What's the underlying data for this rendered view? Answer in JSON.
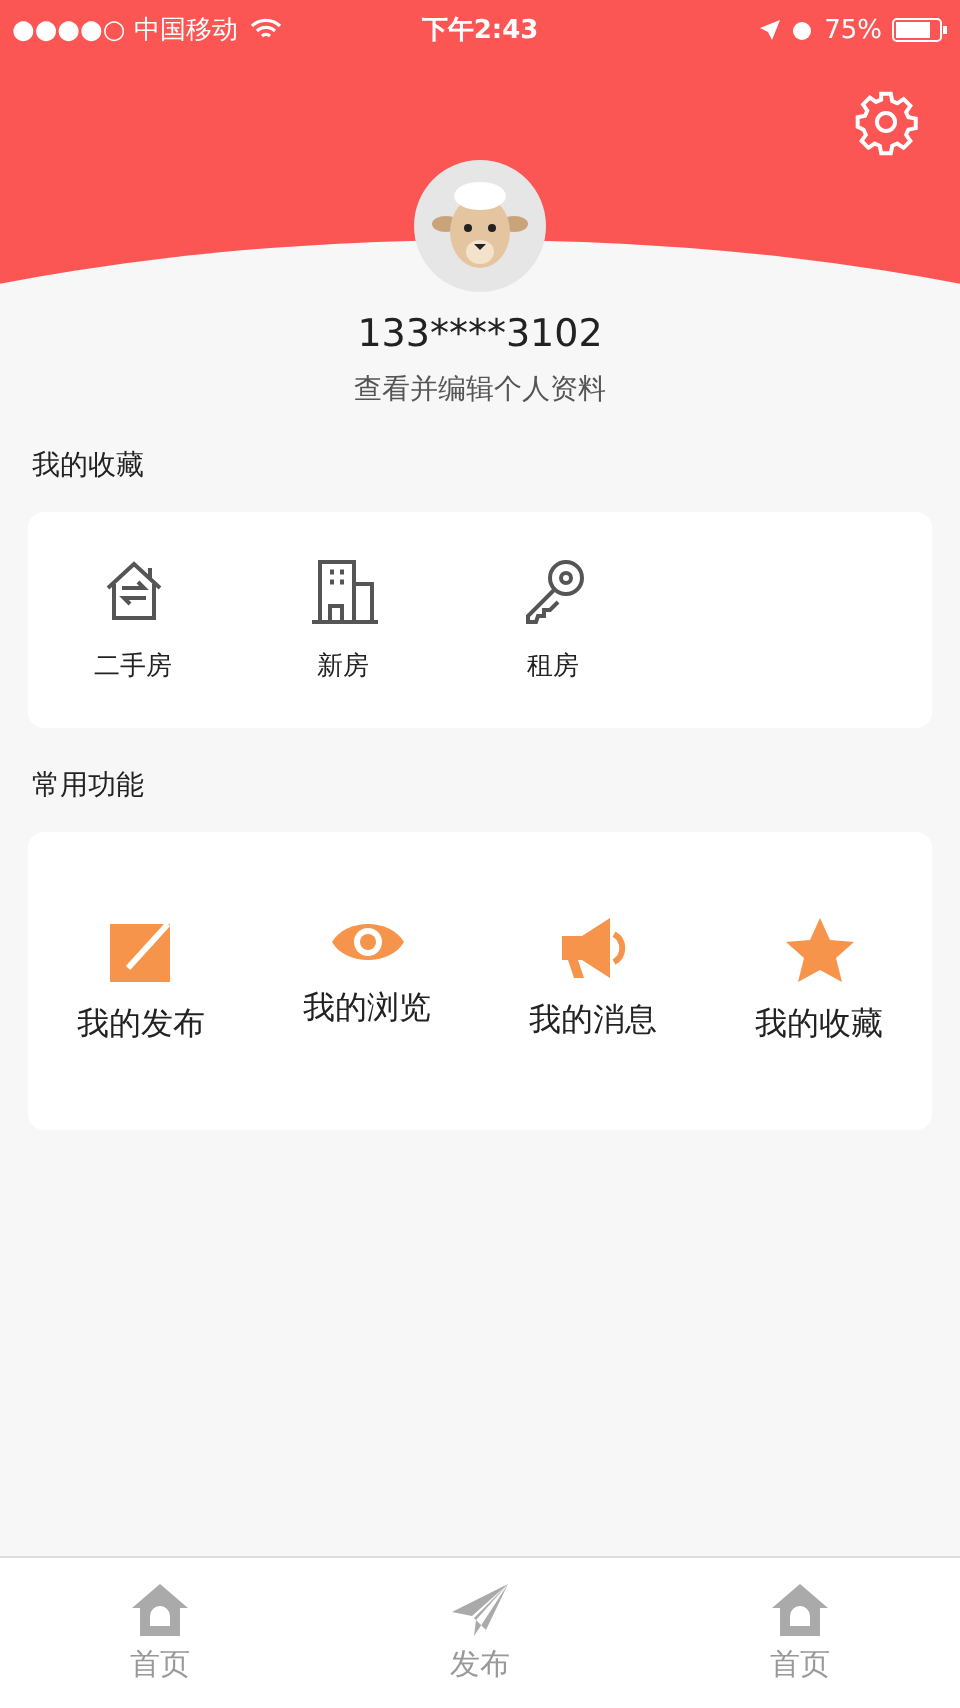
{
  "status_bar": {
    "carrier": "●●●●○ 中国移动",
    "time": "下午2:43",
    "battery": "75%"
  },
  "profile": {
    "phone": "133****3102",
    "subtitle": "查看并编辑个人资料"
  },
  "favorites": {
    "title": "我的收藏",
    "items": [
      {
        "label": "二手房"
      },
      {
        "label": "新房"
      },
      {
        "label": "租房"
      }
    ]
  },
  "functions": {
    "title": "常用功能",
    "items": [
      {
        "label": "我的发布"
      },
      {
        "label": "我的浏览"
      },
      {
        "label": "我的消息"
      },
      {
        "label": "我的收藏"
      }
    ]
  },
  "tab_bar": [
    {
      "label": "首页"
    },
    {
      "label": "发布"
    },
    {
      "label": "首页"
    }
  ]
}
